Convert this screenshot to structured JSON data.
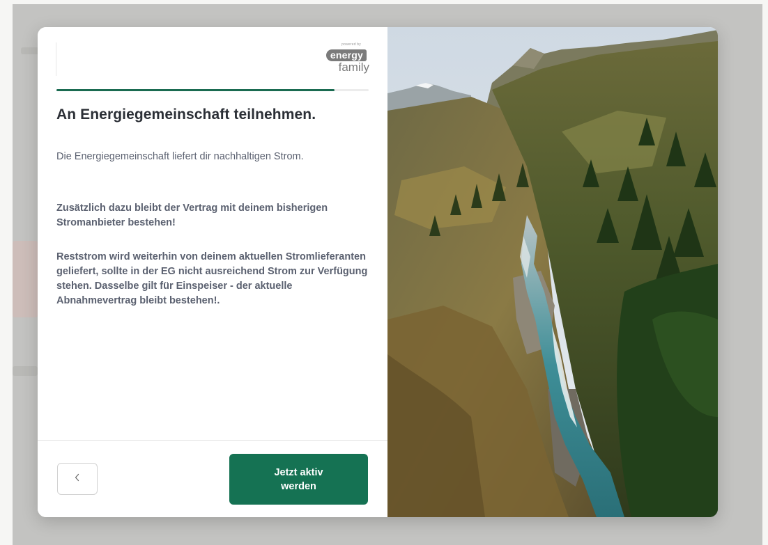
{
  "logo": {
    "powered_by": "powered by",
    "word_top": "energy",
    "word_bottom": "family"
  },
  "progress": {
    "value_percent": 89
  },
  "title": "An Energiegemeinschaft teilnehmen.",
  "intro_text": "Die Energiegemeinschaft liefert dir nachhaltigen Strom.",
  "paragraph_1": "Zusätzlich dazu bleibt der Vertrag mit deinem bisherigen Stromanbieter bestehen!",
  "paragraph_2": "Reststrom wird weiterhin von deinem aktuellen Stromlieferanten geliefert, sollte in der EG nicht ausreichend Strom zur Verfügung stehen. Dasselbe gilt für Einspeiser - der aktuelle Abnahmevertrag bleibt bestehen!.",
  "buttons": {
    "back_icon": "chevron-left-icon",
    "primary_label": "Jetzt aktiv werden"
  },
  "colors": {
    "accent": "#157253",
    "progress_fill": "#1a6b51",
    "text_heading": "#2b2f36",
    "text_body": "#5b6170"
  }
}
